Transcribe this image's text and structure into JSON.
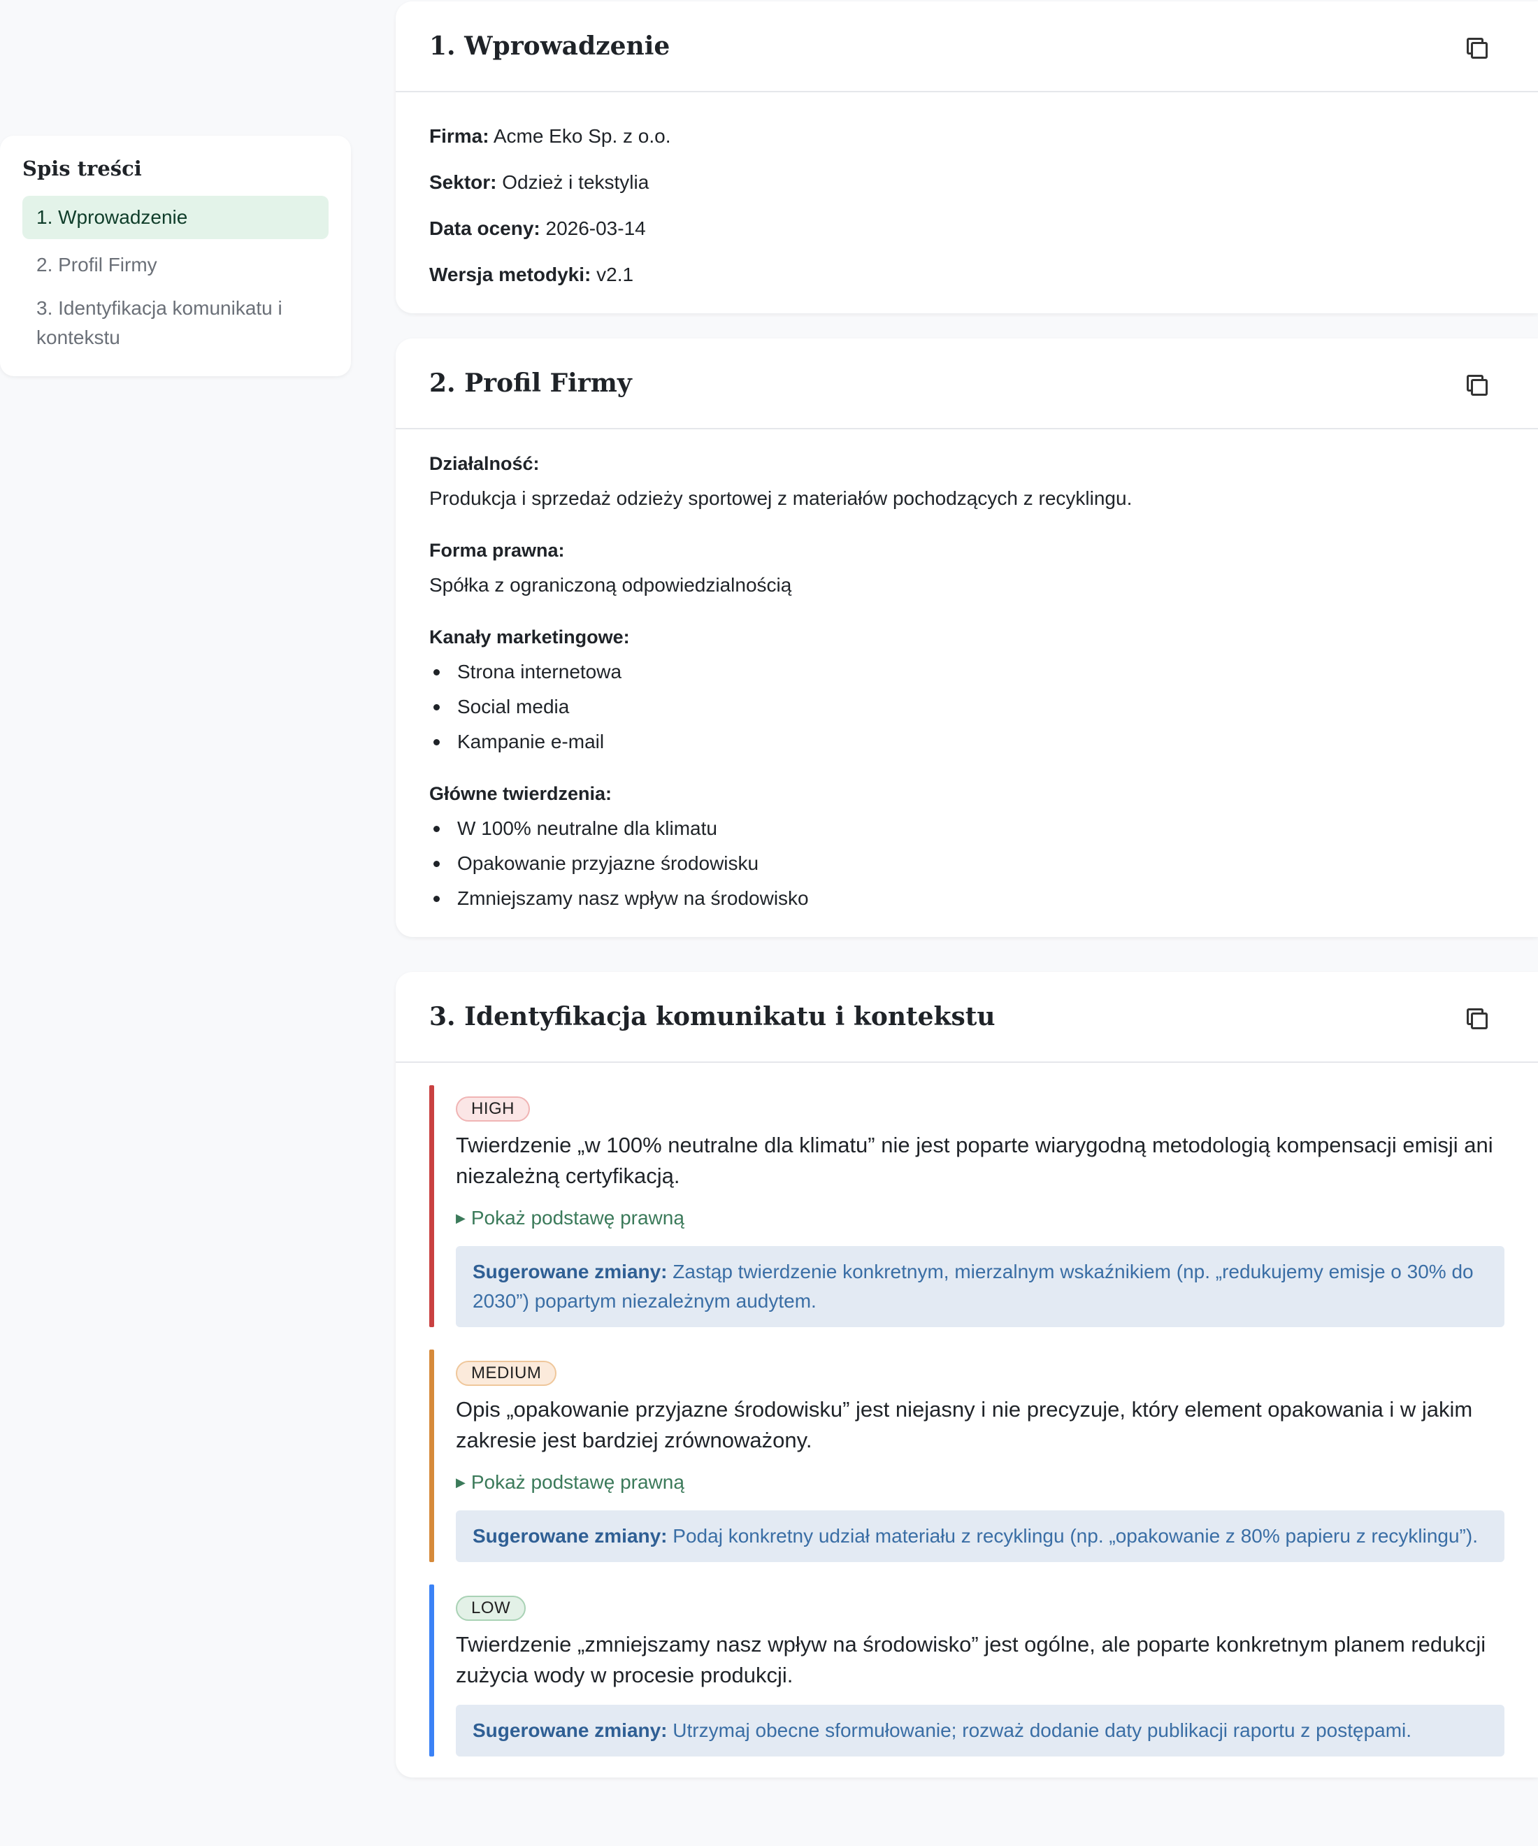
{
  "toc": {
    "title": "Spis treści",
    "items": [
      {
        "label": "1. Wprowadzenie"
      },
      {
        "label": "2. Profil Firmy"
      },
      {
        "label": "3. Identyfikacja komunikatu i kontekstu"
      }
    ]
  },
  "intro": {
    "title": "1. Wprowadzenie",
    "fields": [
      {
        "label": "Firma:",
        "value": "Acme Eko Sp. z o.o."
      },
      {
        "label": "Sektor:",
        "value": "Odzież i tekstylia"
      },
      {
        "label": "Data oceny:",
        "value": "2026-03-14"
      },
      {
        "label": "Wersja metodyki:",
        "value": "v2.1"
      }
    ]
  },
  "profile": {
    "title": "2. Profil Firmy",
    "activity_label": "Działalność:",
    "activity_value": "Produkcja i sprzedaż odzieży sportowej z materiałów pochodzących z recyklingu.",
    "legal_form_label": "Forma prawna:",
    "legal_form_value": "Spółka z ograniczoną odpowiedzialnością",
    "channels_label": "Kanały marketingowe:",
    "channels": [
      "Strona internetowa",
      "Social media",
      "Kampanie e-mail"
    ],
    "claims_label": "Główne twierdzenia:",
    "claims": [
      "W 100% neutralne dla klimatu",
      "Opakowanie przyjazne środowisku",
      "Zmniejszamy nasz wpływ na środowisko"
    ]
  },
  "analysis": {
    "title": "3. Identyfikacja komunikatu i kontekstu",
    "legal_toggle_label": "Pokaż podstawę prawną",
    "suggest_label": "Sugerowane zmiany:",
    "findings": [
      {
        "severity": "HIGH",
        "color": "#c94141",
        "text": "Twierdzenie „w 100% neutralne dla klimatu” nie jest poparte wiarygodną metodologią kompensacji emisji ani niezależną certyfikacją.",
        "suggestion": "Zastąp twierdzenie konkretnym, mierzalnym wskaźnikiem (np. „redukujemy emisje o 30% do 2030”) popartym niezależnym audytem."
      },
      {
        "severity": "MEDIUM",
        "color": "#d68a3a",
        "text": "Opis „opakowanie przyjazne środowisku” jest niejasny i nie precyzuje, który element opakowania i w jakim zakresie jest bardziej zrównoważony.",
        "suggestion": "Podaj konkretny udział materiału z recyklingu (np. „opakowanie z 80% papieru z recyklingu”)."
      },
      {
        "severity": "LOW",
        "color": "#3b82f6",
        "text": "Twierdzenie „zmniejszamy nasz wpływ na środowisko” jest ogólne, ale poparte konkretnym planem redukcji zużycia wody w procesie produkcji.",
        "suggestion": "Utrzymaj obecne sformułowanie; rozważ dodanie daty publikacji raportu z postępami."
      }
    ]
  }
}
